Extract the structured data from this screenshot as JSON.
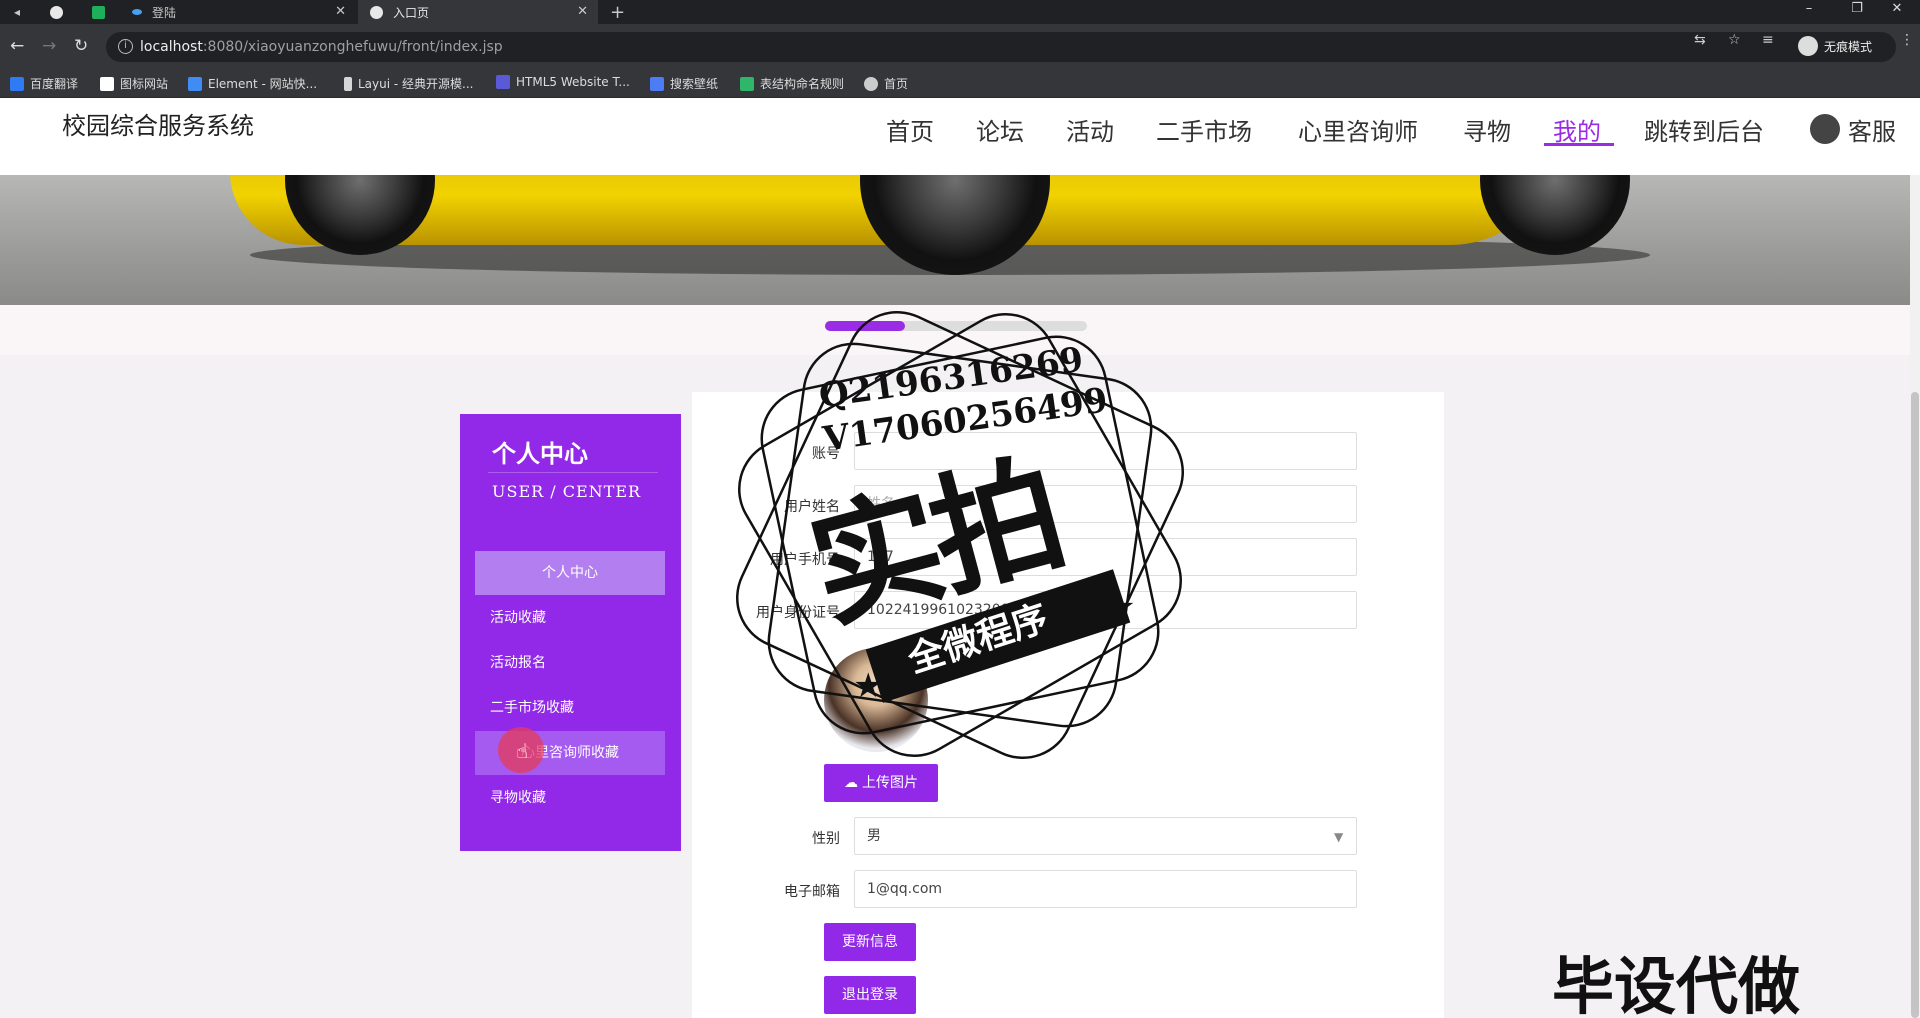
{
  "browser": {
    "tabs": [
      {
        "label": ""
      },
      {
        "label": ""
      },
      {
        "label": ""
      },
      {
        "label": "登陆"
      },
      {
        "label": "入口页"
      }
    ],
    "new_tab": "+",
    "url_host": "localhost",
    "url_path": ":8080/xiaoyuanzonghefuwu/front/index.jsp",
    "profile_label": "无痕模式",
    "bookmarks": [
      {
        "label": "百度翻译",
        "color": "#2f7bf5"
      },
      {
        "label": "图标网站",
        "color": "#ffffff"
      },
      {
        "label": "Element - 网站快...",
        "color": "#3f8cf5"
      },
      {
        "label": "Layui - 经典开源模...",
        "color": "#d6d6d6"
      },
      {
        "label": "HTML5 Website T...",
        "color": "#5a5ad6"
      },
      {
        "label": "搜索壁纸",
        "color": "#4c7df5"
      },
      {
        "label": "表结构命名规则",
        "color": "#2fb66b"
      },
      {
        "label": "首页",
        "color": "#cccccc"
      }
    ]
  },
  "site": {
    "title": "校园综合服务系统",
    "nav": [
      {
        "label": "首页"
      },
      {
        "label": "论坛"
      },
      {
        "label": "活动"
      },
      {
        "label": "二手市场"
      },
      {
        "label": "心里咨询师"
      },
      {
        "label": "寻物"
      },
      {
        "label": "我的",
        "active": true
      },
      {
        "label": "跳转到后台"
      },
      {
        "label": "客服"
      }
    ],
    "accent_color": "#9228e8"
  },
  "sidebar": {
    "title": "个人中心",
    "subtitle": "USER / CENTER",
    "items": [
      {
        "label": "个人中心"
      },
      {
        "label": "活动收藏"
      },
      {
        "label": "活动报名"
      },
      {
        "label": "二手市场收藏"
      },
      {
        "label": "心里咨询师收藏"
      },
      {
        "label": "寻物收藏"
      }
    ]
  },
  "form": {
    "fields": [
      {
        "label": "账号",
        "value": ""
      },
      {
        "label": "用户姓名",
        "value": "",
        "placeholder": "姓名"
      },
      {
        "label": "用户手机号",
        "value": "177"
      },
      {
        "label": "用户身份证号",
        "value": "10224199610232001"
      }
    ],
    "upload_label": "上传图片",
    "gender_label": "性别",
    "gender_value": "男",
    "email_label": "电子邮箱",
    "email_value": "1@qq.com",
    "update_label": "更新信息",
    "logout_label": "退出登录"
  },
  "watermark": {
    "qq": "Q2196316269",
    "v": "V17060256499",
    "big": "实拍",
    "ribbon": "全微程序",
    "bottom": "毕设代做"
  }
}
